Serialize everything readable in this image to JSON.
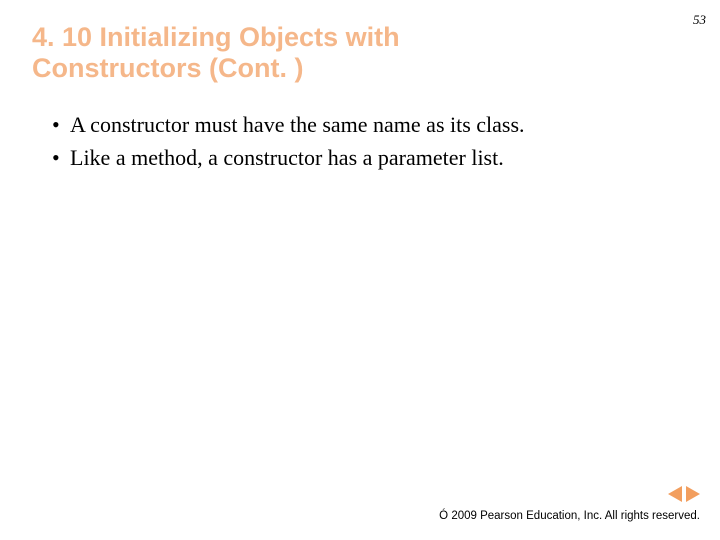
{
  "pageNumber": "53",
  "title": "4. 10  Initializing Objects with Constructors (Cont. )",
  "bullets": [
    "A constructor must have the same name as its class.",
    "Like a method, a constructor has a parameter list."
  ],
  "copyrightSymbol": "Ó",
  "copyrightText": " 2009 Pearson Education, Inc.  All rights reserved.",
  "bulletChar": "•"
}
